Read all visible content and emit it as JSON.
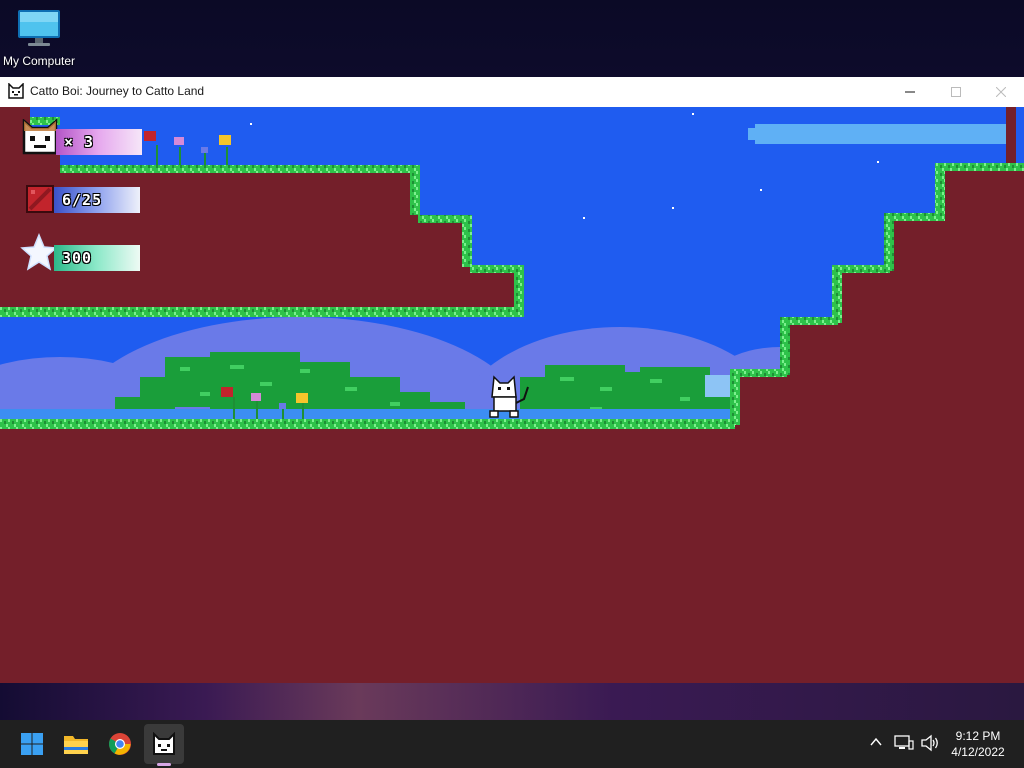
{
  "desktop": {
    "icons": [
      {
        "label": "My Computer",
        "icon": "monitor-icon"
      }
    ]
  },
  "window": {
    "title": "Catto Boi: Journey to Catto Land",
    "app_icon": "cat-face-icon",
    "controls": [
      "minimize-icon",
      "maximize-icon",
      "close-icon"
    ]
  },
  "game": {
    "hud": {
      "lives": {
        "icon": "cat-face-icon",
        "text": "× 3"
      },
      "blocks": {
        "icon": "red-block-icon",
        "text": "6/25"
      },
      "score": {
        "icon": "star-icon",
        "text": "300"
      }
    },
    "colors": {
      "sky": "#1f5cf0",
      "hills": "#6a7ae8",
      "ground": "#741f2a",
      "grass": "#2ec24a",
      "bushes": "#1a9e3a"
    }
  },
  "taskbar": {
    "pinned": [
      {
        "name": "start",
        "icon": "windows-logo-icon"
      },
      {
        "name": "file-explorer",
        "icon": "folder-icon"
      },
      {
        "name": "chrome",
        "icon": "chrome-icon"
      },
      {
        "name": "catto-boi",
        "icon": "cat-face-icon",
        "active": true
      }
    ],
    "tray": [
      "chevron-up-icon",
      "network-icon",
      "volume-icon"
    ],
    "clock": {
      "time": "9:12 PM",
      "date": "4/12/2022"
    }
  }
}
